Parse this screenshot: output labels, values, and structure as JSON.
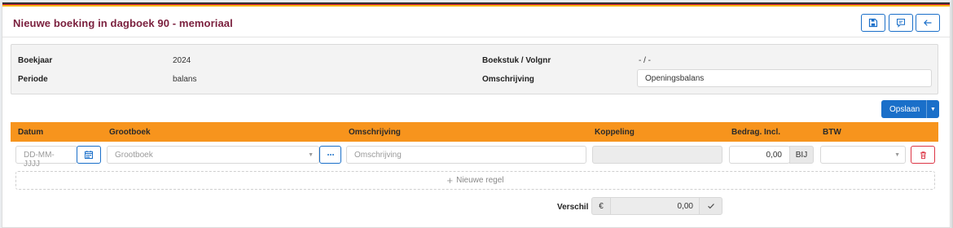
{
  "header": {
    "title": "Nieuwe boeking in dagboek 90 - memoriaal",
    "buttons": [
      {
        "icon": "save-icon"
      },
      {
        "icon": "comment-icon"
      },
      {
        "icon": "arrow-left-icon"
      }
    ]
  },
  "info": {
    "boekjaar_label": "Boekjaar",
    "boekjaar_value": "2024",
    "periode_label": "Periode",
    "periode_value": "balans",
    "boekstuk_label": "Boekstuk / Volgnr",
    "boekstuk_value": "- / -",
    "omschrijving_label": "Omschrijving",
    "omschrijving_value": "Openingsbalans"
  },
  "actions": {
    "save_label": "Opslaan"
  },
  "table": {
    "columns": [
      "Datum",
      "Grootboek",
      "Omschrijving",
      "Koppeling",
      "Bedrag. Incl.",
      "BTW"
    ],
    "row": {
      "date_placeholder": "DD-MM-JJJJ",
      "grootboek_placeholder": "Grootboek",
      "omschrijving_placeholder": "Omschrijving",
      "koppeling_value": "",
      "bedrag_value": "0,00",
      "bedrag_addon": "BIJ",
      "btw_value": ""
    },
    "new_row_label": "Nieuwe regel"
  },
  "footer": {
    "verschil_label": "Verschil",
    "currency": "€",
    "verschil_value": "0,00"
  },
  "colors": {
    "title": "#7a1f3d",
    "accent": "#1a6fc9",
    "table_header": "#f7941d",
    "danger": "#dc3545"
  }
}
